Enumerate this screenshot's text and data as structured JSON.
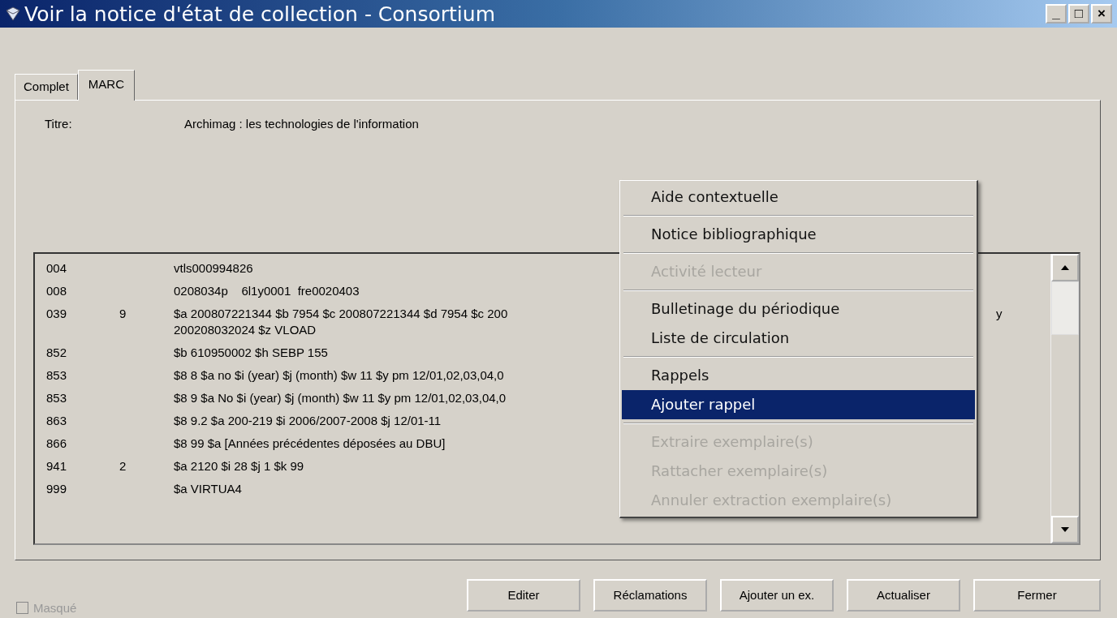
{
  "window": {
    "title": "Voir la notice d'état de collection - Consortium",
    "controls": [
      "_",
      "□",
      "×"
    ]
  },
  "tabs": [
    {
      "label": "Complet",
      "selected": false
    },
    {
      "label": "MARC",
      "selected": true
    }
  ],
  "title_field": {
    "label": "Titre:",
    "value": "Archimag : les technologies de l'information"
  },
  "marc_rows": [
    {
      "tag": "004",
      "indicator": "",
      "lines": [
        "vtls000994826"
      ]
    },
    {
      "tag": "008",
      "indicator": "",
      "lines": [
        "0208034p    6l1y0001  fre0020403"
      ]
    },
    {
      "tag": "039",
      "indicator": "9",
      "lines": [
        "$a 200807221344 $b 7954 $c 200807221344 $d 7954 $c 200",
        "200208032024 $z VLOAD"
      ],
      "tail": "y"
    },
    {
      "tag": "852",
      "indicator": "",
      "lines": [
        "$b 610950002 $h SEBP 155"
      ]
    },
    {
      "tag": "853",
      "indicator": "",
      "lines": [
        "$8 8 $a no $i (year) $j (month) $w 11 $y pm 12/01,02,03,04,0"
      ]
    },
    {
      "tag": "853",
      "indicator": "",
      "lines": [
        "$8 9 $a No $i (year) $j (month) $w 11 $y pm 12/01,02,03,04,0"
      ]
    },
    {
      "tag": "863",
      "indicator": "",
      "lines": [
        "$8 9.2 $a 200-219 $i 2006/2007-2008 $j 12/01-11"
      ]
    },
    {
      "tag": "866",
      "indicator": "",
      "lines": [
        "$8 99 $a [Années précédentes déposées au DBU]"
      ]
    },
    {
      "tag": "941",
      "indicator": "2",
      "lines": [
        "$a 2120 $i 28 $j 1 $k 99"
      ]
    },
    {
      "tag": "999",
      "indicator": "",
      "lines": [
        "$a VIRTUA4"
      ]
    }
  ],
  "context_menu": [
    {
      "kind": "item",
      "label": "Aide contextuelle",
      "disabled": false,
      "selected": false
    },
    {
      "kind": "separator"
    },
    {
      "kind": "item",
      "label": "Notice bibliographique",
      "disabled": false,
      "selected": false
    },
    {
      "kind": "separator"
    },
    {
      "kind": "item",
      "label": "Activité lecteur",
      "disabled": true,
      "selected": false
    },
    {
      "kind": "separator"
    },
    {
      "kind": "item",
      "label": "Bulletinage du périodique",
      "disabled": false,
      "selected": false
    },
    {
      "kind": "item",
      "label": "Liste de circulation",
      "disabled": false,
      "selected": false
    },
    {
      "kind": "separator"
    },
    {
      "kind": "item",
      "label": "Rappels",
      "disabled": false,
      "selected": false
    },
    {
      "kind": "item",
      "label": "Ajouter rappel",
      "disabled": false,
      "selected": true
    },
    {
      "kind": "separator"
    },
    {
      "kind": "item",
      "label": "Extraire exemplaire(s)",
      "disabled": true,
      "selected": false
    },
    {
      "kind": "item",
      "label": "Rattacher exemplaire(s)",
      "disabled": true,
      "selected": false
    },
    {
      "kind": "item",
      "label": "Annuler extraction exemplaire(s)",
      "disabled": true,
      "selected": false
    }
  ],
  "masque": {
    "label": "Masqué",
    "checked": false,
    "disabled": true
  },
  "buttons": [
    "Editer",
    "Réclamations",
    "Ajouter un ex.",
    "Actualiser",
    "Fermer"
  ]
}
